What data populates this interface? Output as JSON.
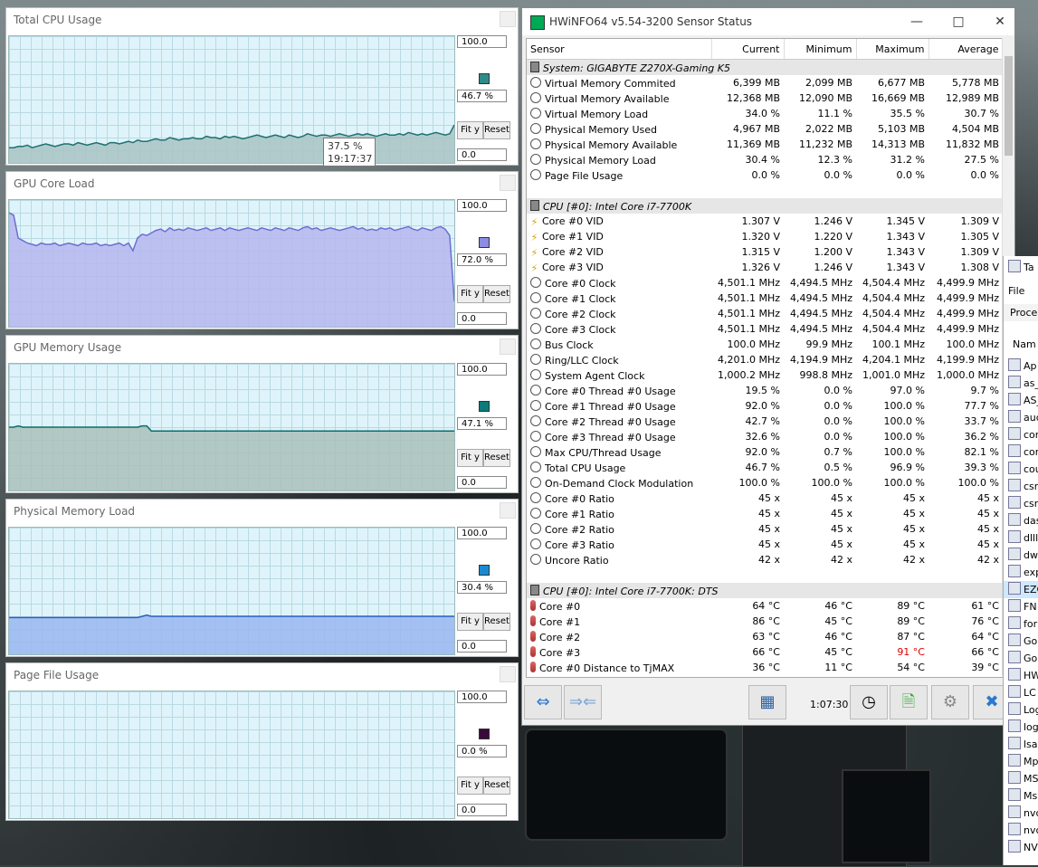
{
  "graphs": [
    {
      "title": "Total CPU Usage",
      "max": "100.0",
      "current": "46.7 %",
      "min": "0.0",
      "color": "#2f8a8a",
      "fill": "#a9c3c3",
      "stroke": "#1f7070",
      "series": [
        12,
        12,
        13,
        13,
        14,
        12,
        13,
        14,
        15,
        14,
        13,
        14,
        15,
        15,
        14,
        16,
        15,
        14,
        15,
        16,
        15,
        14,
        16,
        16,
        15,
        16,
        17,
        16,
        18,
        17,
        17,
        18,
        19,
        18,
        18,
        20,
        19,
        18,
        19,
        19,
        20,
        19,
        19,
        21,
        20,
        20,
        19,
        21,
        20,
        21,
        20,
        19,
        20,
        21,
        22,
        21,
        20,
        21,
        22,
        21,
        20,
        22,
        21,
        20,
        21,
        23,
        22,
        21,
        22,
        22,
        21,
        22,
        23,
        22,
        21,
        22,
        23,
        22,
        23,
        22,
        21,
        22,
        23,
        22,
        22,
        23,
        22,
        24,
        23,
        22,
        23,
        22,
        23,
        24,
        23,
        22,
        23,
        30
      ]
    },
    {
      "title": "GPU Core Load",
      "max": "100.0",
      "current": "72.0 %",
      "min": "0.0",
      "color": "#8c8ce0",
      "fill": "#b6b6ee",
      "stroke": "#6e6ed0",
      "series": [
        90,
        88,
        70,
        68,
        66,
        65,
        64,
        66,
        65,
        65,
        66,
        64,
        65,
        66,
        65,
        64,
        66,
        65,
        65,
        66,
        64,
        65,
        64,
        65,
        66,
        64,
        66,
        60,
        70,
        73,
        72,
        74,
        76,
        77,
        75,
        78,
        76,
        77,
        76,
        78,
        77,
        76,
        77,
        78,
        76,
        77,
        78,
        76,
        78,
        77,
        76,
        77,
        78,
        77,
        76,
        78,
        77,
        76,
        78,
        77,
        76,
        78,
        77,
        76,
        78,
        79,
        77,
        78,
        76,
        77,
        78,
        77,
        76,
        77,
        78,
        79,
        77,
        78,
        76,
        77,
        76,
        78,
        77,
        78,
        76,
        77,
        78,
        79,
        77,
        76,
        78,
        77,
        76,
        78,
        79,
        77,
        72,
        20
      ]
    },
    {
      "title": "GPU Memory Usage",
      "max": "100.0",
      "current": "47.1 %",
      "min": "0.0",
      "color": "#0e7a7a",
      "fill": "#a9c0b8",
      "stroke": "#0c6d6d",
      "series": [
        50,
        50,
        51,
        50,
        50,
        50,
        50,
        50,
        50,
        50,
        50,
        50,
        50,
        50,
        50,
        50,
        50,
        50,
        50,
        50,
        50,
        50,
        50,
        50,
        50,
        50,
        50,
        50,
        50,
        51,
        51,
        47,
        47,
        47,
        47,
        47,
        47,
        47,
        47,
        47,
        47,
        47,
        47,
        47,
        47,
        47,
        47,
        47,
        47,
        47,
        47,
        47,
        47,
        47,
        47,
        47,
        47,
        47,
        47,
        47,
        47,
        47,
        47,
        47,
        47,
        47,
        47,
        47,
        47,
        47,
        47,
        47,
        47,
        47,
        47,
        47,
        47,
        47,
        47,
        47,
        47,
        47,
        47,
        47,
        47,
        47,
        47,
        47,
        47,
        47,
        47,
        47,
        47,
        47,
        47,
        47,
        47,
        47
      ]
    },
    {
      "title": "Physical Memory Load",
      "max": "100.0",
      "current": "30.4 %",
      "min": "0.0",
      "color": "#1a8ad0",
      "fill": "#9ab6f0",
      "stroke": "#2a5fc0",
      "series": [
        29,
        29,
        29,
        29,
        29,
        29,
        29,
        29,
        29,
        29,
        29,
        29,
        29,
        29,
        29,
        29,
        29,
        29,
        29,
        29,
        29,
        29,
        29,
        29,
        29,
        29,
        29,
        29,
        29,
        30,
        31,
        30,
        30,
        30,
        30,
        30,
        30,
        30,
        30,
        30,
        30,
        30,
        30,
        30,
        30,
        30,
        30,
        30,
        30,
        30,
        30,
        30,
        30,
        30,
        30,
        30,
        30,
        30,
        30,
        30,
        30,
        30,
        30,
        30,
        30,
        30,
        30,
        30,
        30,
        30,
        30,
        30,
        30,
        30,
        30,
        30,
        30,
        30,
        30,
        30,
        30,
        30,
        30,
        30,
        30,
        30,
        30,
        30,
        30,
        30,
        30,
        30,
        30,
        30,
        30,
        30,
        30,
        30
      ]
    },
    {
      "title": "Page File Usage",
      "max": "100.0",
      "current": "0.0 %",
      "min": "0.0",
      "color": "#3a0a3a",
      "fill": "#dff4fa",
      "stroke": "#dff4fa",
      "series": [
        0,
        0
      ]
    }
  ],
  "fit_label": "Fit y",
  "reset_label": "Reset",
  "tooltip": {
    "value": "37.5 %",
    "time": "19:17:37"
  },
  "hwinfo": {
    "title": "HWiNFO64 v5.54-3200 Sensor Status",
    "columns": [
      "Sensor",
      "Current",
      "Minimum",
      "Maximum",
      "Average"
    ],
    "rows": [
      {
        "type": "group",
        "icon": "chip",
        "label": "System: GIGABYTE Z270X-Gaming K5"
      },
      {
        "icon": "circle",
        "label": "Virtual Memory Commited",
        "v": [
          "6,399 MB",
          "2,099 MB",
          "6,677 MB",
          "5,778 MB"
        ]
      },
      {
        "icon": "circle",
        "label": "Virtual Memory Available",
        "v": [
          "12,368 MB",
          "12,090 MB",
          "16,669 MB",
          "12,989 MB"
        ]
      },
      {
        "icon": "circle",
        "label": "Virtual Memory Load",
        "v": [
          "34.0 %",
          "11.1 %",
          "35.5 %",
          "30.7 %"
        ]
      },
      {
        "icon": "circle",
        "label": "Physical Memory Used",
        "v": [
          "4,967 MB",
          "2,022 MB",
          "5,103 MB",
          "4,504 MB"
        ]
      },
      {
        "icon": "circle",
        "label": "Physical Memory Available",
        "v": [
          "11,369 MB",
          "11,232 MB",
          "14,313 MB",
          "11,832 MB"
        ]
      },
      {
        "icon": "circle",
        "label": "Physical Memory Load",
        "v": [
          "30.4 %",
          "12.3 %",
          "31.2 %",
          "27.5 %"
        ]
      },
      {
        "icon": "circle",
        "label": "Page File Usage",
        "v": [
          "0.0 %",
          "0.0 %",
          "0.0 %",
          "0.0 %"
        ]
      },
      {
        "type": "blank"
      },
      {
        "type": "group",
        "icon": "chip",
        "label": "CPU [#0]: Intel Core i7-7700K"
      },
      {
        "icon": "bolt",
        "label": "Core #0 VID",
        "v": [
          "1.307 V",
          "1.246 V",
          "1.345 V",
          "1.309 V"
        ]
      },
      {
        "icon": "bolt",
        "label": "Core #1 VID",
        "v": [
          "1.320 V",
          "1.220 V",
          "1.343 V",
          "1.305 V"
        ]
      },
      {
        "icon": "bolt",
        "label": "Core #2 VID",
        "v": [
          "1.315 V",
          "1.200 V",
          "1.343 V",
          "1.309 V"
        ]
      },
      {
        "icon": "bolt",
        "label": "Core #3 VID",
        "v": [
          "1.326 V",
          "1.246 V",
          "1.343 V",
          "1.308 V"
        ]
      },
      {
        "icon": "circle",
        "label": "Core #0 Clock",
        "v": [
          "4,501.1 MHz",
          "4,494.5 MHz",
          "4,504.4 MHz",
          "4,499.9 MHz"
        ]
      },
      {
        "icon": "circle",
        "label": "Core #1 Clock",
        "v": [
          "4,501.1 MHz",
          "4,494.5 MHz",
          "4,504.4 MHz",
          "4,499.9 MHz"
        ]
      },
      {
        "icon": "circle",
        "label": "Core #2 Clock",
        "v": [
          "4,501.1 MHz",
          "4,494.5 MHz",
          "4,504.4 MHz",
          "4,499.9 MHz"
        ]
      },
      {
        "icon": "circle",
        "label": "Core #3 Clock",
        "v": [
          "4,501.1 MHz",
          "4,494.5 MHz",
          "4,504.4 MHz",
          "4,499.9 MHz"
        ]
      },
      {
        "icon": "circle",
        "label": "Bus Clock",
        "v": [
          "100.0 MHz",
          "99.9 MHz",
          "100.1 MHz",
          "100.0 MHz"
        ]
      },
      {
        "icon": "circle",
        "label": "Ring/LLC Clock",
        "v": [
          "4,201.0 MHz",
          "4,194.9 MHz",
          "4,204.1 MHz",
          "4,199.9 MHz"
        ]
      },
      {
        "icon": "circle",
        "label": "System Agent Clock",
        "v": [
          "1,000.2 MHz",
          "998.8 MHz",
          "1,001.0 MHz",
          "1,000.0 MHz"
        ]
      },
      {
        "icon": "circle",
        "label": "Core #0 Thread #0 Usage",
        "v": [
          "19.5 %",
          "0.0 %",
          "97.0 %",
          "9.7 %"
        ]
      },
      {
        "icon": "circle",
        "label": "Core #1 Thread #0 Usage",
        "v": [
          "92.0 %",
          "0.0 %",
          "100.0 %",
          "77.7 %"
        ]
      },
      {
        "icon": "circle",
        "label": "Core #2 Thread #0 Usage",
        "v": [
          "42.7 %",
          "0.0 %",
          "100.0 %",
          "33.7 %"
        ]
      },
      {
        "icon": "circle",
        "label": "Core #3 Thread #0 Usage",
        "v": [
          "32.6 %",
          "0.0 %",
          "100.0 %",
          "36.2 %"
        ]
      },
      {
        "icon": "circle",
        "label": "Max CPU/Thread Usage",
        "v": [
          "92.0 %",
          "0.7 %",
          "100.0 %",
          "82.1 %"
        ]
      },
      {
        "icon": "circle",
        "label": "Total CPU Usage",
        "v": [
          "46.7 %",
          "0.5 %",
          "96.9 %",
          "39.3 %"
        ]
      },
      {
        "icon": "circle",
        "label": "On-Demand Clock Modulation",
        "v": [
          "100.0 %",
          "100.0 %",
          "100.0 %",
          "100.0 %"
        ]
      },
      {
        "icon": "circle",
        "label": "Core #0 Ratio",
        "v": [
          "45 x",
          "45 x",
          "45 x",
          "45 x"
        ]
      },
      {
        "icon": "circle",
        "label": "Core #1 Ratio",
        "v": [
          "45 x",
          "45 x",
          "45 x",
          "45 x"
        ]
      },
      {
        "icon": "circle",
        "label": "Core #2 Ratio",
        "v": [
          "45 x",
          "45 x",
          "45 x",
          "45 x"
        ]
      },
      {
        "icon": "circle",
        "label": "Core #3 Ratio",
        "v": [
          "45 x",
          "45 x",
          "45 x",
          "45 x"
        ]
      },
      {
        "icon": "circle",
        "label": "Uncore Ratio",
        "v": [
          "42 x",
          "42 x",
          "42 x",
          "42 x"
        ]
      },
      {
        "type": "blank"
      },
      {
        "type": "group",
        "icon": "chip",
        "label": "CPU [#0]: Intel Core i7-7700K: DTS"
      },
      {
        "icon": "temp",
        "label": "Core #0",
        "v": [
          "64 °C",
          "46 °C",
          "89 °C",
          "61 °C"
        ]
      },
      {
        "icon": "temp",
        "label": "Core #1",
        "v": [
          "86 °C",
          "45 °C",
          "89 °C",
          "76 °C"
        ]
      },
      {
        "icon": "temp",
        "label": "Core #2",
        "v": [
          "63 °C",
          "46 °C",
          "87 °C",
          "64 °C"
        ]
      },
      {
        "icon": "temp",
        "label": "Core #3",
        "v": [
          "66 °C",
          "45 °C",
          "91 °C",
          "66 °C"
        ],
        "red": 2
      },
      {
        "icon": "temp",
        "label": "Core #0 Distance to TjMAX",
        "v": [
          "36 °C",
          "11 °C",
          "54 °C",
          "39 °C"
        ]
      }
    ],
    "timer": "1:07:30"
  },
  "taskmgr": {
    "menu": "File",
    "tab": "Proce",
    "title": "Ta",
    "col": "Nam",
    "items": [
      "Ap",
      "as_",
      "AS_",
      "auc",
      "cor",
      "cor",
      "cou",
      "csr",
      "csr",
      "das",
      "dlll",
      "dw",
      "exp",
      "EZC",
      "FN",
      "for",
      "Go",
      "Go",
      "HW",
      "LC",
      "Log",
      "log",
      "lsa",
      "Mp",
      "MS",
      "Ms",
      "nvc",
      "nvc",
      "NV"
    ]
  }
}
